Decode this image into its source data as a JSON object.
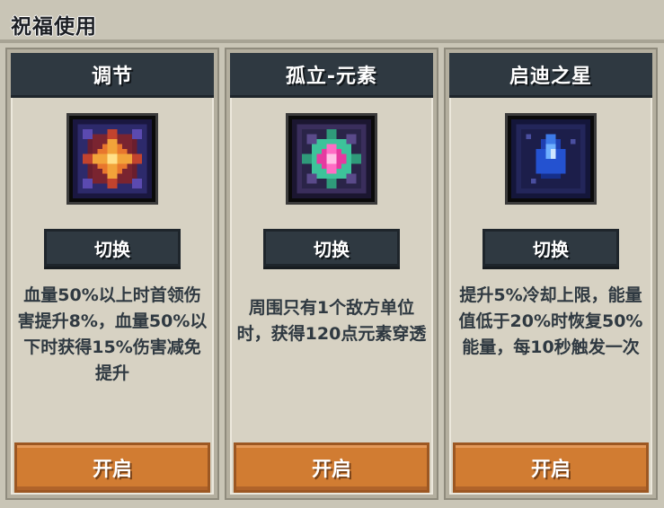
{
  "window": {
    "title": "祝福使用"
  },
  "blessings": [
    {
      "name": "调节",
      "icon": "orange-star-icon",
      "switch_label": "切换",
      "description": "血量50%以上时首领伤害提升8%，血量50%以下时获得15%伤害减免提升",
      "enable_label": "开启"
    },
    {
      "name": "孤立-元素",
      "icon": "pink-gem-icon",
      "switch_label": "切换",
      "description": "周围只有1个敌方单位时，获得120点元素穿透",
      "enable_label": "开启"
    },
    {
      "name": "启迪之星",
      "icon": "blue-crystal-icon",
      "switch_label": "切换",
      "description": "提升5%冷却上限，能量值低于20%时恢复50%能量，每10秒触发一次",
      "enable_label": "开启"
    }
  ],
  "colors": {
    "panel_header": "#2f3941",
    "enable_button": "#d17c32",
    "background": "#c9c5b6"
  }
}
